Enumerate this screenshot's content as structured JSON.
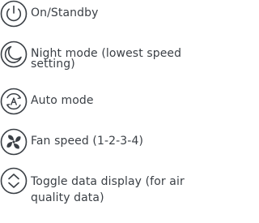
{
  "legend": {
    "items": [
      {
        "icon": "power-icon",
        "label": "On/Standby"
      },
      {
        "icon": "moon-icon",
        "label": "Night mode (lowest speed setting)"
      },
      {
        "icon": "auto-mode-icon",
        "label": "Auto mode"
      },
      {
        "icon": "fan-icon",
        "label": "Fan speed (1-2-3-4)"
      },
      {
        "icon": "toggle-chevron-icon",
        "label": "Toggle data display (for air quality data)"
      }
    ]
  }
}
